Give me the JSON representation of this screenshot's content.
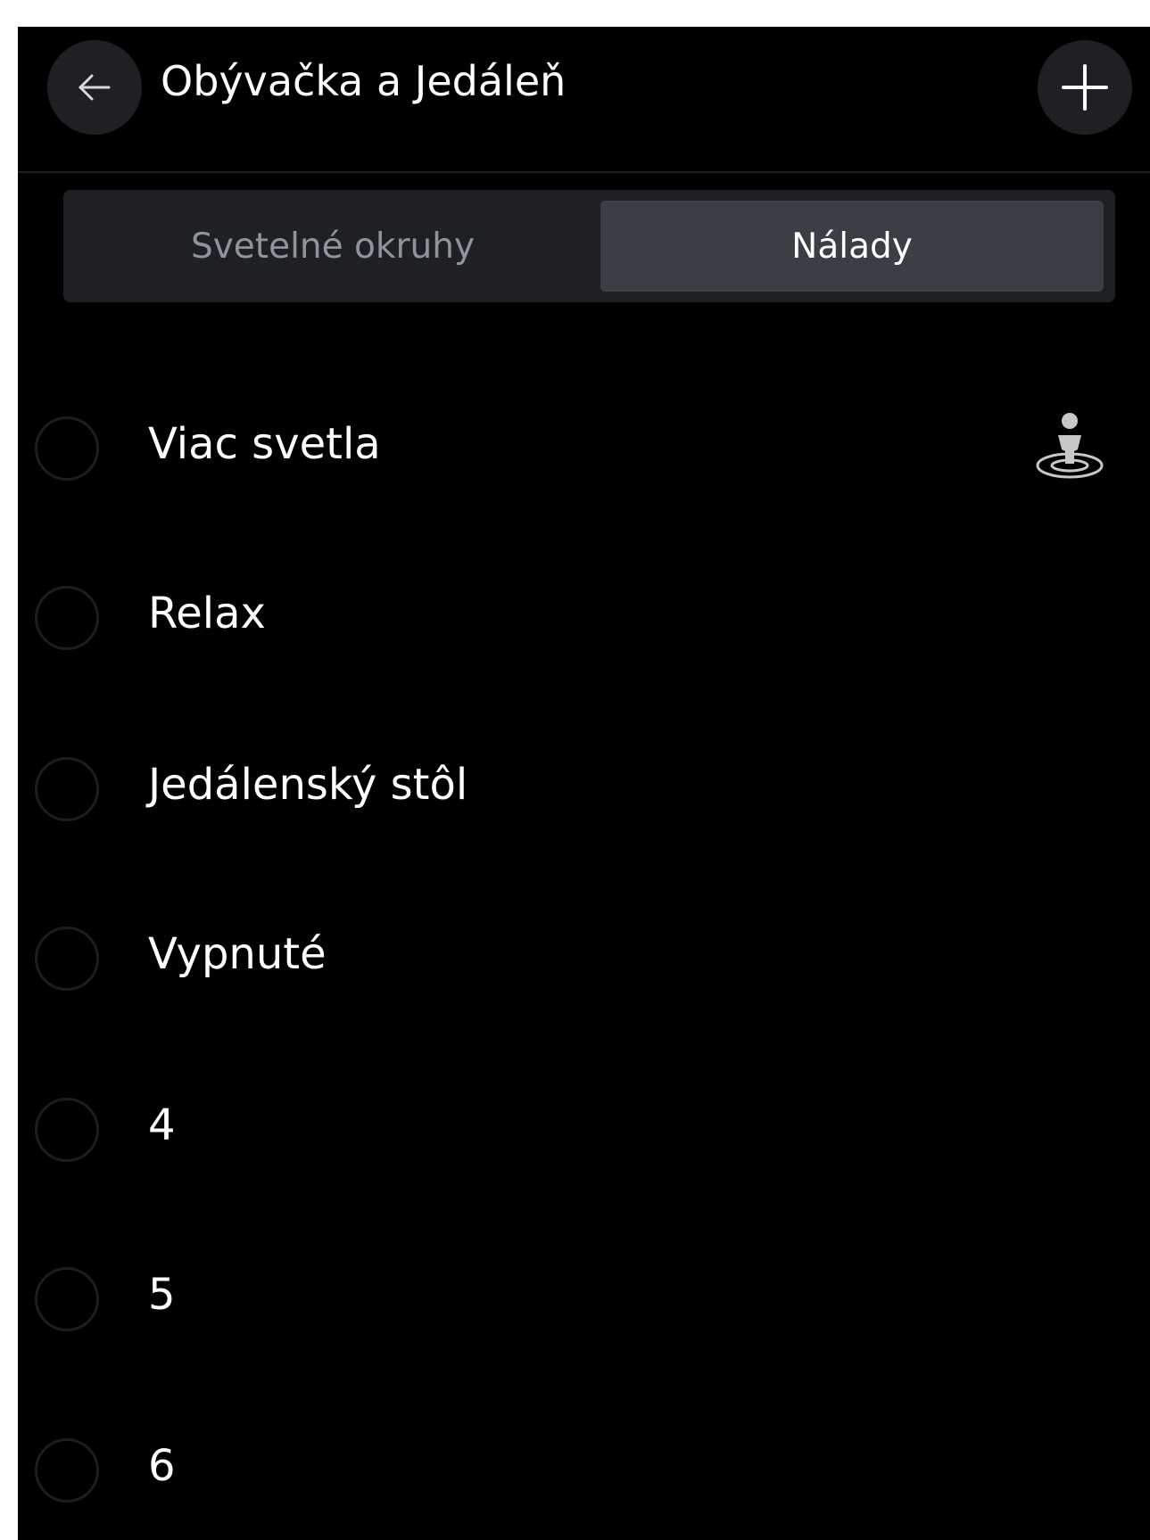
{
  "header": {
    "title": "Obývačka a Jedáleň",
    "back_icon": "arrow-left-icon",
    "add_icon": "plus-icon"
  },
  "tabs": [
    {
      "label": "Svetelné okruhy",
      "active": false
    },
    {
      "label": "Nálady",
      "active": true
    }
  ],
  "moods": [
    {
      "label": "Viac svetla",
      "icon": "presence-person-icon"
    },
    {
      "label": "Relax"
    },
    {
      "label": "Jedálenský stôl"
    },
    {
      "label": "Vypnuté"
    },
    {
      "label": "4"
    },
    {
      "label": "5"
    },
    {
      "label": "6"
    }
  ],
  "colors": {
    "background": "#000000",
    "button_bg": "#1e2024",
    "tab_active_bg": "#3a3f45",
    "tab_inactive_text": "#8f949c",
    "text": "#ffffff"
  }
}
